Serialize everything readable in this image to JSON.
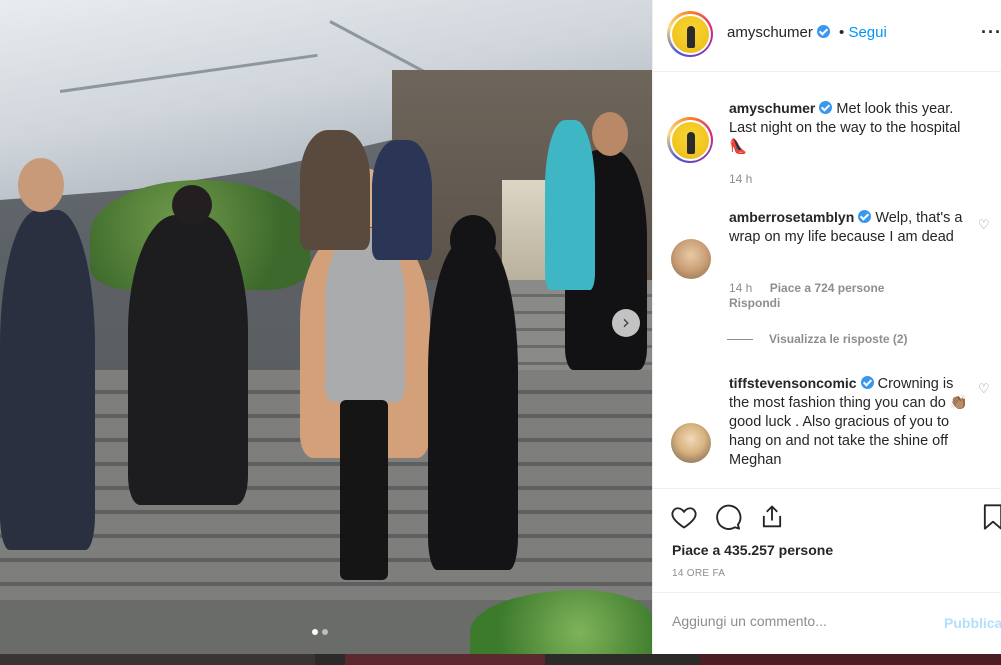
{
  "post": {
    "username": "amyschumer",
    "follow_separator": "•",
    "follow_label": "Segui",
    "more_icon": "more-horizontal-icon",
    "photo": {
      "carousel_next_icon": "chevron-right-icon",
      "carousel_position": 1,
      "carousel_total": 2
    }
  },
  "caption": {
    "username": "amyschumer",
    "text": "Met look this year. Last night on the way to the hospital 👠",
    "time": "14 h"
  },
  "comments": [
    {
      "username": "amberrosetamblyn",
      "text": "Welp, that's a wrap on my life because I am dead",
      "time": "14 h",
      "likes": "Piace a 724 persone",
      "reply": "Rispondi",
      "view_replies": "Visualizza le risposte (2)"
    },
    {
      "username": "tiffstevensoncomic",
      "text": "Crowning is the most fashion thing you can do 👏🏽 good luck . Also gracious of you to hang on and not take the shine off Meghan"
    }
  ],
  "actions": {
    "like_icon": "heart-icon",
    "comment_icon": "comment-icon",
    "share_icon": "share-icon",
    "save_icon": "bookmark-icon",
    "likes_text": "Piace a 435.257 persone",
    "timestamp": "14 ORE FA"
  },
  "add_comment": {
    "placeholder": "Aggiungi un commento...",
    "publish_label": "Pubblica"
  },
  "colors": {
    "link_blue": "#0095f6",
    "verified_blue": "#3897f0",
    "publish_disabled": "#b2dffc",
    "muted_text": "#8e8e8e"
  }
}
